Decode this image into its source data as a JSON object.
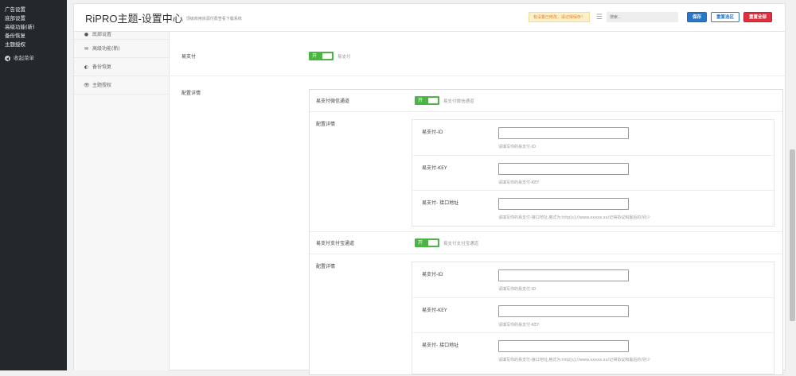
{
  "wp_menu": {
    "items": [
      "广告设置",
      "底部设置",
      "高级功能(新)",
      "备份恢复",
      "主题授权"
    ],
    "collapse_label": "收起菜单"
  },
  "header": {
    "title": "RiPRO主题-设置中心",
    "subtitle": "顶级商用资源付费查看下载系统",
    "notice": "有设置已修改，请记得保存！",
    "search_placeholder": "搜索...",
    "save_label": "保存",
    "reset_section_label": "重置选区",
    "reset_all_label": "重置全部"
  },
  "nav": {
    "partial_item": "底部设置",
    "items": [
      {
        "label": "高级功能(新)",
        "icon": "envelope-icon"
      },
      {
        "label": "备份恢复",
        "icon": "contrast-icon"
      },
      {
        "label": "主题授权",
        "icon": "eye-icon"
      }
    ]
  },
  "main": {
    "epay_label": "易支付",
    "epay_toggle_on": "开",
    "epay_toggle_desc": "易支付",
    "config_label": "配置详情",
    "wechat": {
      "label": "易支付微信通道",
      "toggle_on": "开",
      "toggle_desc": "易支付微信通道",
      "config_label": "配置详情",
      "fields": [
        {
          "label": "易支付-ID",
          "value": "",
          "hint": "请填写你的易支付-ID"
        },
        {
          "label": "易支付-KEY",
          "value": "",
          "hint": "请填写你的易支付-KEY"
        },
        {
          "label": "易支付- 接口地址",
          "value": "",
          "hint": "请填写你的易支付-接口地址,格式为:http[s]://www.xxxxx.xx/记得协议和最后的/别少"
        }
      ]
    },
    "alipay": {
      "label": "易支付支付宝通道",
      "toggle_on": "开",
      "toggle_desc": "易支付支付宝通道",
      "config_label": "配置详情",
      "fields": [
        {
          "label": "易支付-ID",
          "value": "",
          "hint": "请填写你的易支付-ID"
        },
        {
          "label": "易支付-KEY",
          "value": "",
          "hint": "请填写你的易支付-KEY"
        },
        {
          "label": "易支付- 接口地址",
          "value": "",
          "hint": "请填写你的易支付-接口地址,格式为:http[s]://www.xxxxx.xx/记得协议和最后的/别少"
        }
      ]
    }
  },
  "colors": {
    "toggle_on": "#4bb543",
    "save": "#2878c8",
    "reset_all": "#e03040",
    "sidebar": "#23282d"
  }
}
